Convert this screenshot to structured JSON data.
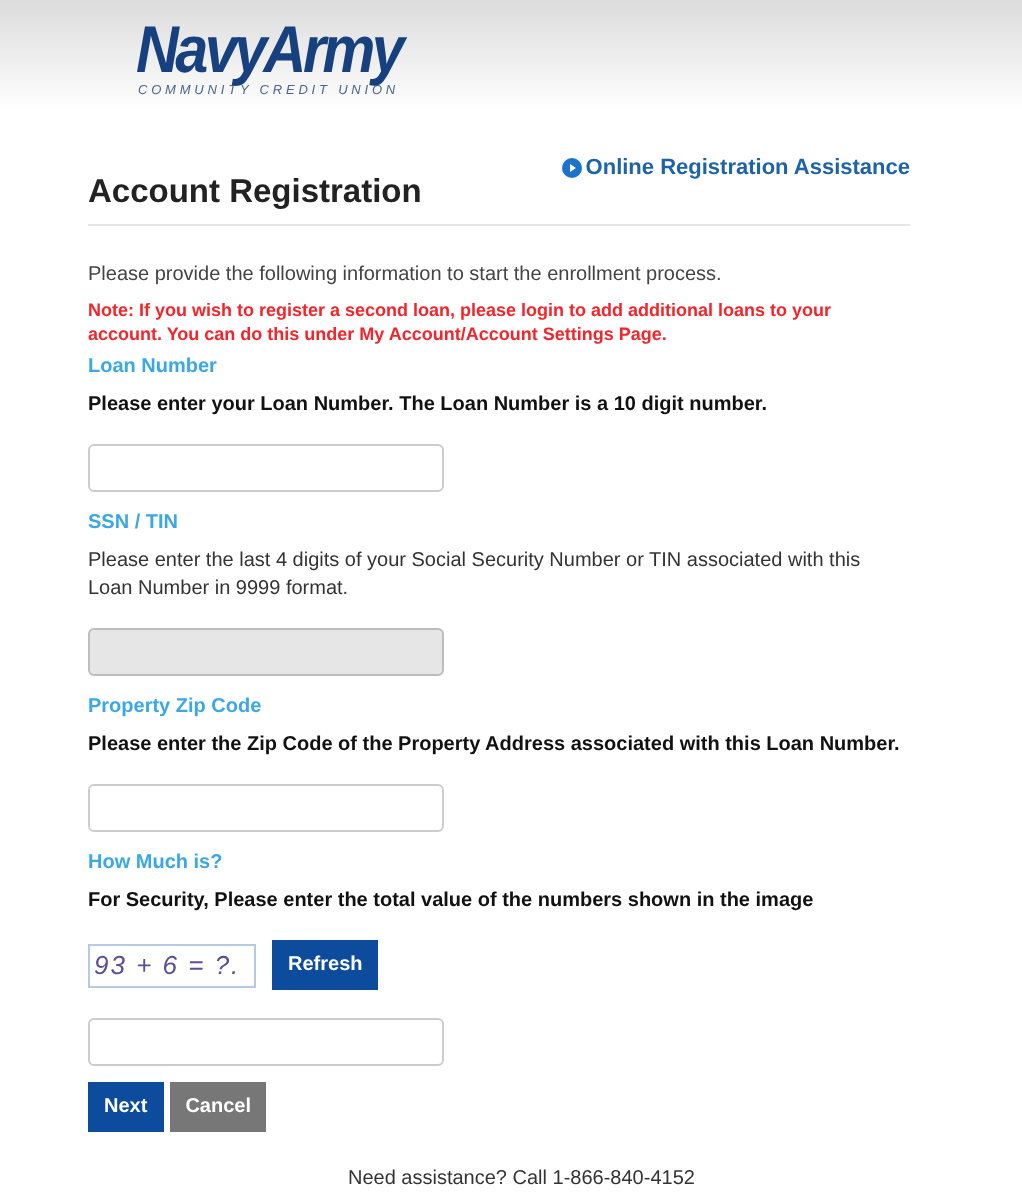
{
  "logo": {
    "name": "NavyArmy",
    "tagline": "COMMUNITY CREDIT UNION"
  },
  "title": "Account Registration",
  "help_link": "Online Registration Assistance",
  "intro": "Please provide the following information to start the enrollment process.",
  "note": "Note: If you wish to register a second loan, please login to add additional loans to your account. You can do this under My Account/Account Settings Page.",
  "sections": [
    {
      "heading": "Loan Number",
      "instruction": "Please enter your Loan Number. The Loan Number is a 10 digit number.",
      "bold": true,
      "disabled": false
    },
    {
      "heading": "SSN / TIN",
      "instruction": "Please enter the last 4 digits of your Social Security Number or TIN associated with this Loan Number in 9999 format.",
      "bold": false,
      "disabled": true
    },
    {
      "heading": "Property Zip Code",
      "instruction": "Please enter the Zip Code of the Property Address associated with this Loan Number.",
      "bold": true,
      "disabled": false
    },
    {
      "heading": "How Much is?",
      "instruction": "For Security, Please enter the total value of the numbers shown in the image",
      "bold": true,
      "disabled": false,
      "captcha": {
        "text": "93 + 6 = ?.",
        "button": "Refresh"
      }
    }
  ],
  "buttons": [
    {
      "label": "Next",
      "kind": "primary"
    },
    {
      "label": "Cancel",
      "kind": "secondary"
    }
  ],
  "footer": "Need assistance? Call 1-866-840-4152"
}
